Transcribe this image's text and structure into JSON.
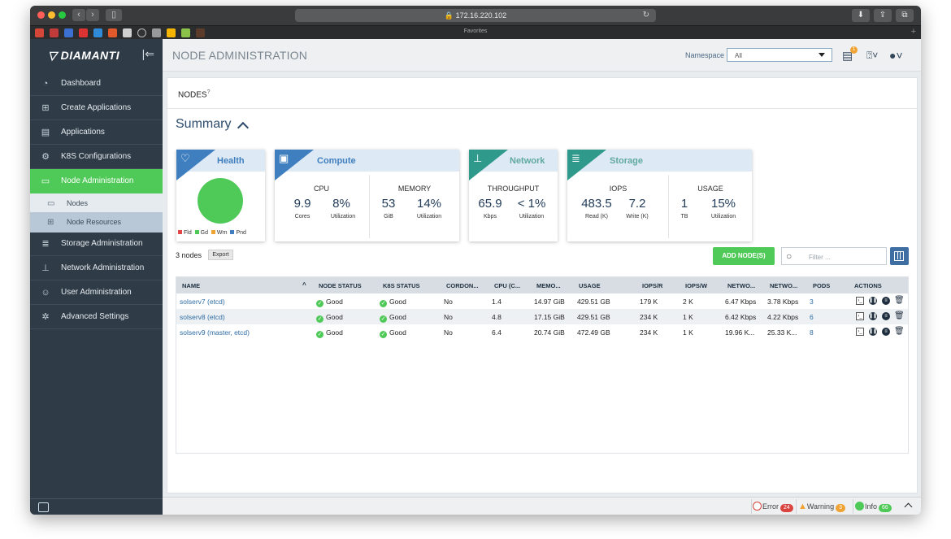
{
  "browser": {
    "url": "172.16.220.102",
    "favorites_label": "Favorites"
  },
  "sidebar": {
    "brand": "DIAMANTI",
    "items": [
      {
        "label": "Dashboard",
        "icon": "speedometer-icon"
      },
      {
        "label": "Create Applications",
        "icon": "plus-box-icon"
      },
      {
        "label": "Applications",
        "icon": "list-icon"
      },
      {
        "label": "K8S Configurations",
        "icon": "gear-cluster-icon"
      },
      {
        "label": "Node Administration",
        "icon": "server-icon",
        "active": true
      },
      {
        "label": "Storage Administration",
        "icon": "database-icon"
      },
      {
        "label": "Network Administration",
        "icon": "network-icon"
      },
      {
        "label": "User Administration",
        "icon": "users-icon"
      },
      {
        "label": "Advanced Settings",
        "icon": "settings-icon"
      }
    ],
    "subitems": [
      {
        "label": "Nodes",
        "icon": "monitor-icon"
      },
      {
        "label": "Node Resources",
        "icon": "resources-icon",
        "selected": true
      }
    ]
  },
  "header": {
    "title": "NODE ADMINISTRATION",
    "namespace_label": "Namespace",
    "namespace_value": "All",
    "notification_count": "1"
  },
  "tab": {
    "label": "NODES",
    "help": "?"
  },
  "summary": {
    "title": "Summary",
    "health": {
      "title": "Health",
      "legend": [
        "Fld",
        "Gd",
        "Wrn",
        "Pnd"
      ],
      "legend_colors": [
        "#e04848",
        "#4fc957",
        "#f0a232",
        "#3f7fbf"
      ]
    },
    "compute": {
      "title": "Compute",
      "cpu_label": "CPU",
      "cpu_cores": "9.9",
      "cpu_cores_unit": "Cores",
      "cpu_util": "8%",
      "cpu_util_unit": "Utilization",
      "mem_label": "MEMORY",
      "mem_size": "53",
      "mem_size_unit": "GiB",
      "mem_util": "14%",
      "mem_util_unit": "Utilization"
    },
    "network": {
      "title": "Network",
      "label": "THROUGHPUT",
      "value": "65.9",
      "value_unit": "Kbps",
      "util": "< 1%",
      "util_unit": "Utilization"
    },
    "storage": {
      "title": "Storage",
      "iops_label": "IOPS",
      "read": "483.5",
      "read_unit": "Read (K)",
      "write": "7.2",
      "write_unit": "Write (K)",
      "usage_label": "USAGE",
      "usage_tb": "1",
      "usage_tb_unit": "TB",
      "usage_util": "15%",
      "usage_util_unit": "Utilization"
    }
  },
  "toolbar": {
    "node_count": "3 nodes",
    "export_label": "Export",
    "add_label": "ADD NODE(S)",
    "filter_placeholder": "Filter ..."
  },
  "table": {
    "headers": [
      "NAME",
      "NODE STATUS",
      "K8S STATUS",
      "CORDON...",
      "CPU (C...",
      "MEMO...",
      "USAGE",
      "IOPS/R",
      "IOPS/W",
      "NETWO...",
      "NETWO...",
      "PODS",
      "ACTIONS"
    ],
    "rows": [
      {
        "name": "solserv7 (etcd)",
        "node_status": "Good",
        "k8s_status": "Good",
        "cordoned": "No",
        "cpu": "1.4",
        "memory": "14.97 GiB",
        "usage": "429.51 GB",
        "iops_r": "179 K",
        "iops_w": "2 K",
        "net_in": "6.47 Kbps",
        "net_out": "3.78 Kbps",
        "pods": "3"
      },
      {
        "name": "solserv8 (etcd)",
        "node_status": "Good",
        "k8s_status": "Good",
        "cordoned": "No",
        "cpu": "4.8",
        "memory": "17.15 GiB",
        "usage": "429.51 GB",
        "iops_r": "234 K",
        "iops_w": "1 K",
        "net_in": "6.42 Kbps",
        "net_out": "4.22 Kbps",
        "pods": "6"
      },
      {
        "name": "solserv9 (master, etcd)",
        "node_status": "Good",
        "k8s_status": "Good",
        "cordoned": "No",
        "cpu": "6.4",
        "memory": "20.74 GiB",
        "usage": "472.49 GB",
        "iops_r": "234 K",
        "iops_w": "1 K",
        "net_in": "19.96 K...",
        "net_out": "25.33 K...",
        "pods": "8"
      }
    ]
  },
  "statusbar": {
    "error_label": "Error",
    "error_count": "24",
    "warning_label": "Warning",
    "warning_count": "3",
    "info_label": "Info",
    "info_count": "66"
  }
}
